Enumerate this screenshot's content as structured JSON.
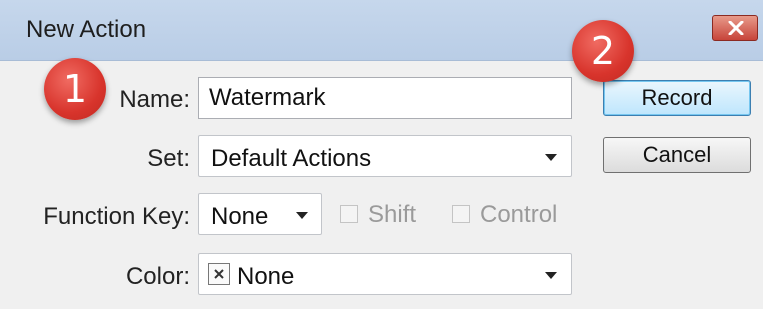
{
  "window": {
    "title": "New Action",
    "close_icon": "close-icon"
  },
  "badges": {
    "one": "1",
    "two": "2"
  },
  "form": {
    "name_label": "Name:",
    "name_value": "Watermark",
    "set_label": "Set:",
    "set_value": "Default Actions",
    "function_key_label": "Function Key:",
    "function_key_value": "None",
    "shift_label": "Shift",
    "control_label": "Control",
    "color_label": "Color:",
    "color_value": "None"
  },
  "buttons": {
    "record": "Record",
    "cancel": "Cancel"
  },
  "colors": {
    "badge": "#d8342c",
    "titlebar": "#c6d7ec",
    "close": "#c7443a"
  }
}
